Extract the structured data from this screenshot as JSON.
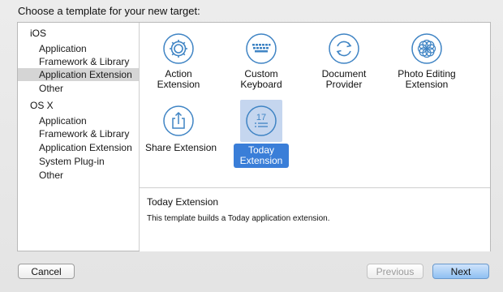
{
  "dialog": {
    "title": "Choose a template for your new target:"
  },
  "sidebar": {
    "groups": [
      {
        "header": "iOS",
        "items": [
          {
            "label": "Application",
            "selected": false
          },
          {
            "label": "Framework & Library",
            "selected": false
          },
          {
            "label": "Application Extension",
            "selected": true
          },
          {
            "label": "Other",
            "selected": false
          }
        ]
      },
      {
        "header": "OS X",
        "items": [
          {
            "label": "Application",
            "selected": false
          },
          {
            "label": "Framework & Library",
            "selected": false
          },
          {
            "label": "Application Extension",
            "selected": false
          },
          {
            "label": "System Plug-in",
            "selected": false
          },
          {
            "label": "Other",
            "selected": false
          }
        ]
      }
    ]
  },
  "templates": [
    {
      "line1": "Action",
      "line2": "Extension",
      "icon": "gear-icon",
      "selected": false
    },
    {
      "line1": "Custom",
      "line2": "Keyboard",
      "icon": "keyboard-icon",
      "selected": false
    },
    {
      "line1": "Document",
      "line2": "Provider",
      "icon": "refresh-icon",
      "selected": false
    },
    {
      "line1": "Photo Editing",
      "line2": "Extension",
      "icon": "flower-icon",
      "selected": false
    },
    {
      "line1": "Share Extension",
      "line2": "",
      "icon": "share-icon",
      "selected": false
    },
    {
      "line1": "Today",
      "line2": "Extension",
      "icon": "calendar-list-icon",
      "icon_text": "17",
      "selected": true
    }
  ],
  "description": {
    "title": "Today Extension",
    "body": "This template builds a Today application extension."
  },
  "buttons": {
    "cancel": "Cancel",
    "previous": "Previous",
    "next": "Next"
  },
  "colors": {
    "selection_blue": "#3a7ed8",
    "icon_blue": "#3f84c4"
  }
}
